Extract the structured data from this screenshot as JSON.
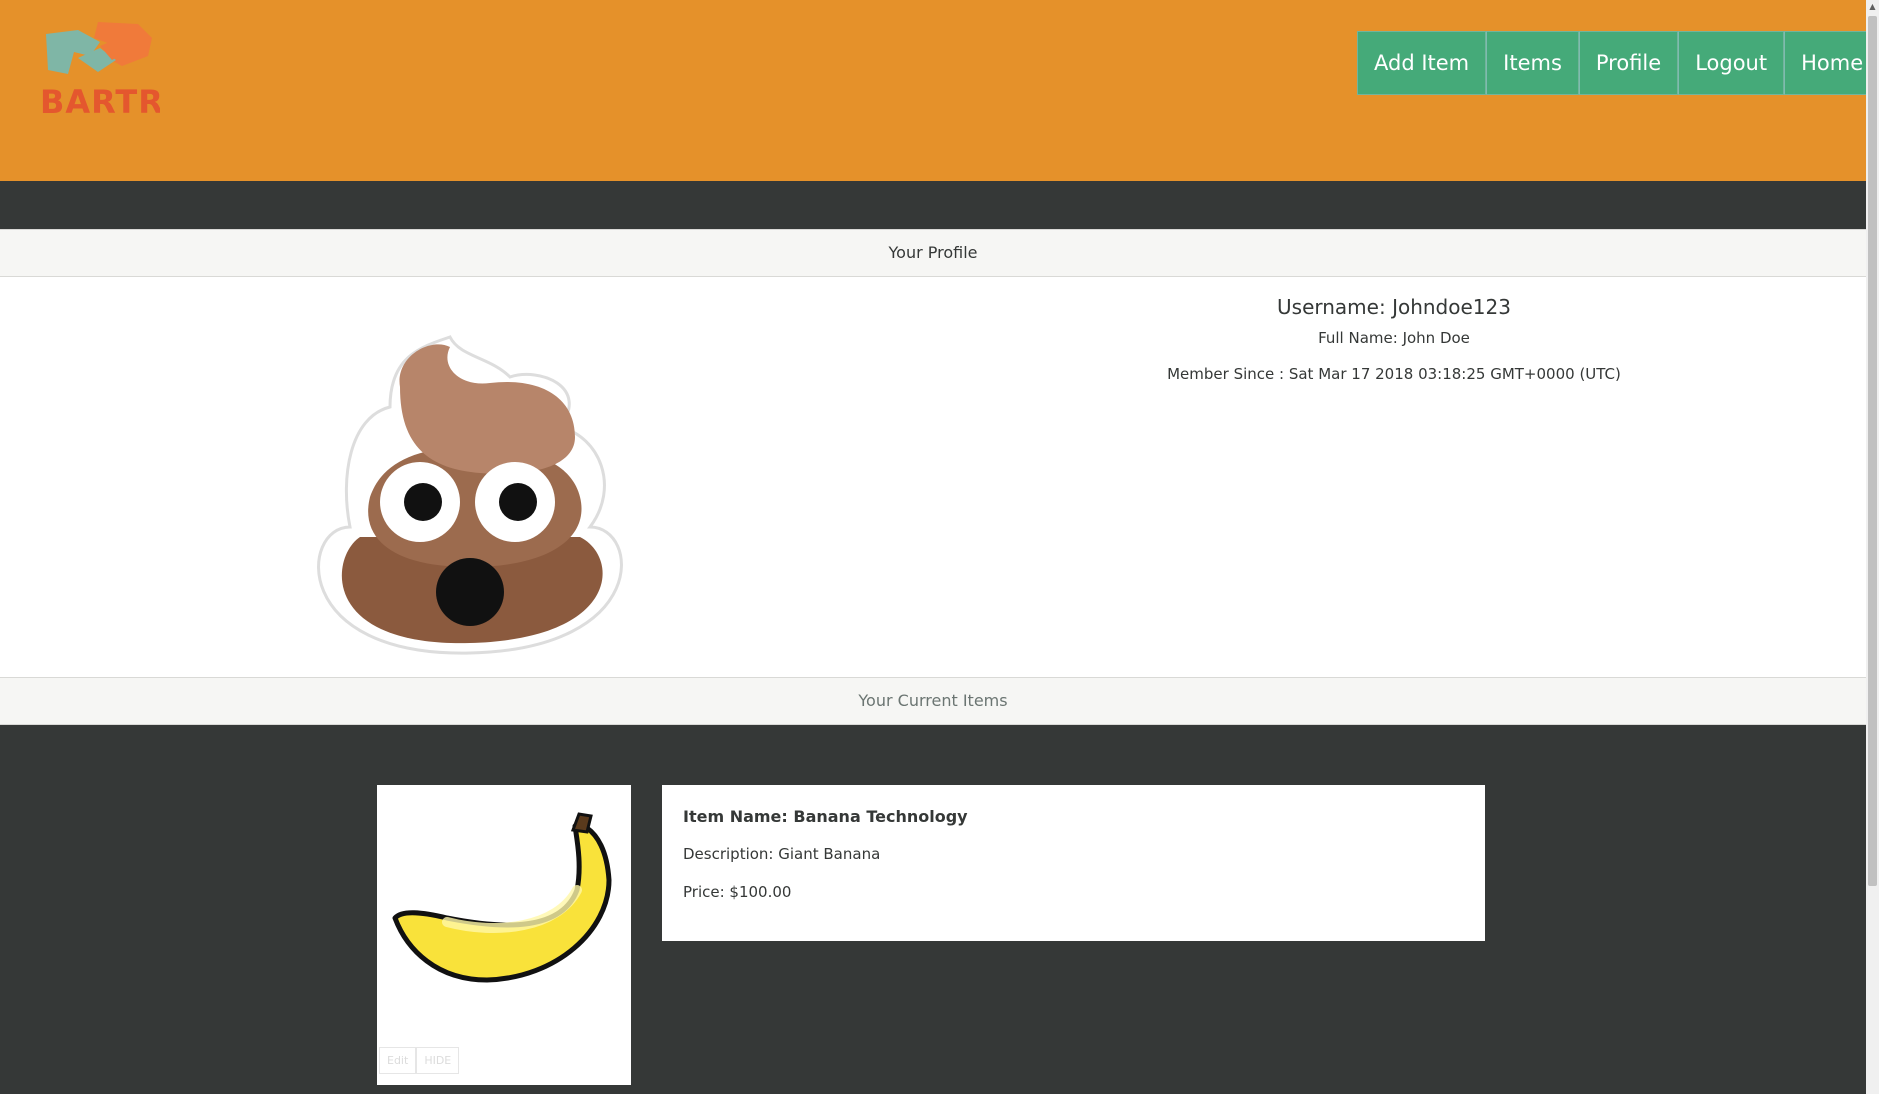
{
  "brand": {
    "logo_text": "BARTR"
  },
  "nav": {
    "items": [
      {
        "label": "Add Item"
      },
      {
        "label": "Items"
      },
      {
        "label": "Profile"
      },
      {
        "label": "Logout"
      },
      {
        "label": "Home"
      }
    ]
  },
  "profile_section": {
    "title": "Your Profile"
  },
  "profile": {
    "username": "Username: Johndoe123",
    "full_name": "Full Name: John Doe",
    "member_since": "Member Since : Sat Mar 17 2018 03:18:25 GMT+0000 (UTC)",
    "avatar_icon": "poop-emoji-avatar"
  },
  "items_section": {
    "title": "Your Current Items"
  },
  "items": [
    {
      "name": "Item Name: Banana Technology",
      "description": "Description: Giant Banana",
      "price": "Price: $100.00",
      "edit_label": "Edit",
      "hide_label": "HIDE",
      "image_icon": "banana-image"
    }
  ],
  "colors": {
    "header_bg": "#e5912a",
    "nav_bg": "#45aa79",
    "dark_bg": "#353837",
    "section_bar_bg": "#f6f6f4"
  }
}
